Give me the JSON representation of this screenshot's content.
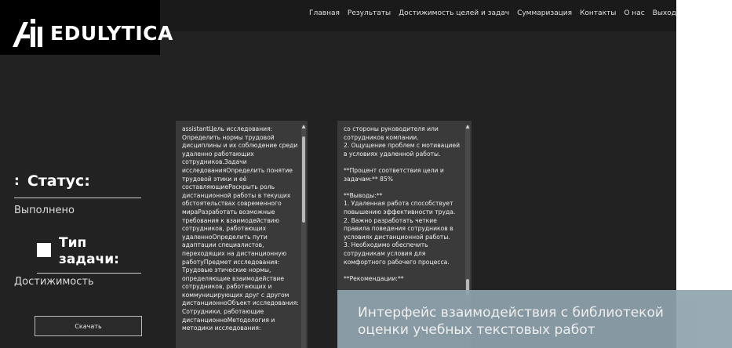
{
  "brand": {
    "name": "EDULYTICA"
  },
  "nav": [
    "Главная",
    "Результаты",
    "Достижимость целей и задач",
    "Суммаризация",
    "Контакты",
    "О нас",
    "Выход"
  ],
  "status": {
    "title": "Статус:",
    "value": "Выполнено"
  },
  "task_type": {
    "title": "Тип задачи:",
    "line1": "Тип",
    "line2": "задачи:",
    "value": "Достижимость"
  },
  "download_label": "Скачать",
  "panel_left_text": "assistantЦель исследования:\nОпределить нормы трудовой\nдисциплины и их соблюдение среди\nудаленно работающих\nсотрудников.Задачи\nисследованияОпределить понятие\nтрудовой этики и её\nсоставляющиеРаскрыть роль\nдистанционной работы в текущих\nобстоятельствах современного\nмираРазработать возможные\nтребования к взаимодействию\nсотрудников, работающих\nудаленноОпределить пути\nадаптации специалистов,\nпереходящих на дистанционную\nработуПредмет исследования:\nТрудовые этические нормы,\nопределяющие взаимодействие\nсотрудников, работающих и\nкоммуницирующих друг с другом\nдистанционноОбъект исследования:\nСотрудники, работающие\nдистанционноМетодология и\nметодики исследования:",
  "panel_right_text": "со стороны руководителя или\nсотрудников компании.\n2. Ощущение проблем с мотивацией\nв условиях удаленной работы.\n\n**Процент соответствия цели и\nзадачам:** 85%\n\n**Выводы:**\n1. Удаленная работа способствует\nповышению эффективности труда.\n2. Важно разработать четкие\nправила поведения сотрудников в\nусловиях дистанционной работы.\n3. Необходимо обеспечить\nсотрудникам условия для\nкомфортного рабочего процесса.\n\n**Рекомендации:**",
  "caption": {
    "line1": "Интерфейс взаимодействия с библиотекой",
    "line2": "оценки учебных текстовых работ"
  },
  "colors": {
    "background": "#222222",
    "panel": "#3a3a3a",
    "caption": "#8fa3ad"
  }
}
